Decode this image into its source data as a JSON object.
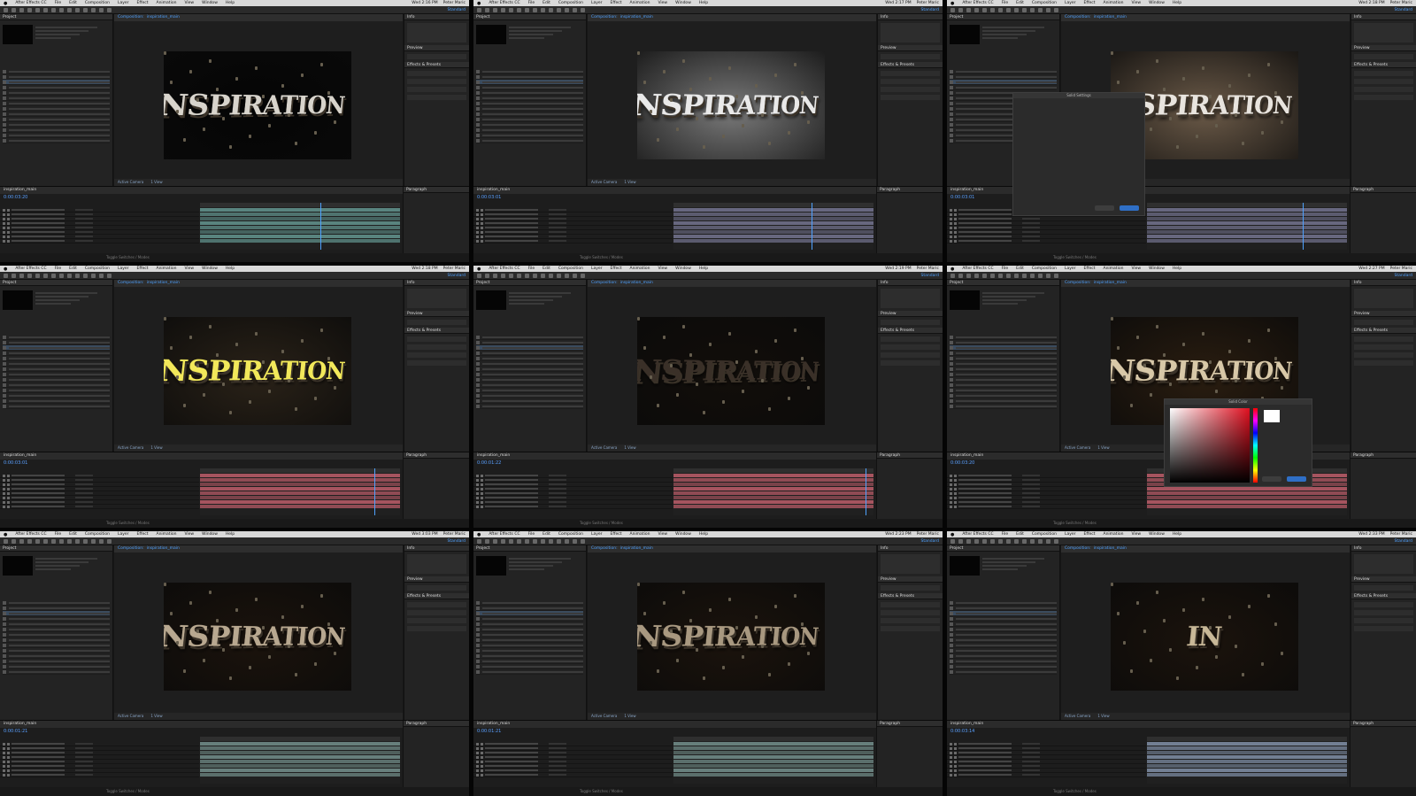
{
  "menubar": {
    "app_name": "After Effects CC",
    "menus": [
      "File",
      "Edit",
      "Composition",
      "Layer",
      "Effect",
      "Animation",
      "View",
      "Window",
      "Help"
    ],
    "user": "Peter Maric"
  },
  "common": {
    "project_tab": "Project",
    "comp_tab_prefix": "Composition:",
    "timeline_tab": "inspiration_main",
    "info_tab": "Info",
    "preview_tab": "Preview",
    "effects_tab": "Effects & Presets",
    "paragraph_tab": "Paragraph",
    "status_text": "Toggle Switches / Modes",
    "view_mode": "Active Camera",
    "view_count": "1 View",
    "workspace": "Standard"
  },
  "frames": [
    {
      "time": "Wed 2:16 PM",
      "timecode": "0:00:03:20",
      "title_text": "INSPIRATION",
      "title_color": "#d8d4cc",
      "bg": "#050505",
      "track_color": "#5f8f8a",
      "dialog": ""
    },
    {
      "time": "Wed 2:17 PM",
      "timecode": "0:00:03:01",
      "title_text": "INSPIRATION",
      "title_color": "#e9e9e9",
      "bg": "#7a7a7a",
      "track_color": "#6f6f8a",
      "dialog": ""
    },
    {
      "time": "Wed 2:18 PM",
      "timecode": "0:00:03:01",
      "title_text": "INSPIRATION",
      "title_color": "#e8e4de",
      "bg": "#6b5a48",
      "track_color": "#6f6f8a",
      "dialog": "Solid Settings"
    },
    {
      "time": "Wed 2:18 PM",
      "timecode": "0:00:03:01",
      "title_text": "INSPIRATION",
      "title_color": "#f2e85a",
      "bg": "#2a2218",
      "track_color": "#b55a66",
      "dialog": ""
    },
    {
      "time": "Wed 2:19 PM",
      "timecode": "0:00:01:22",
      "title_text": "INSPIRATION",
      "title_color": "#3a3028",
      "bg": "#120e0a",
      "track_color": "#b55a66",
      "dialog": ""
    },
    {
      "time": "Wed 2:27 PM",
      "timecode": "0:00:03:20",
      "title_text": "INSPIRATION",
      "title_color": "#d8c8a8",
      "bg": "#2a1d10",
      "track_color": "#b55a66",
      "dialog": "Solid Color"
    },
    {
      "time": "Wed 3:03 PM",
      "timecode": "0:00:01:21",
      "title_text": "INSPIRATION",
      "title_color": "#b8a890",
      "bg": "#1b130c",
      "track_color": "#6f8a86",
      "dialog": ""
    },
    {
      "time": "Wed 2:23 PM",
      "timecode": "0:00:01:21",
      "title_text": "INSPIRATION",
      "title_color": "#a89880",
      "bg": "#1b130c",
      "track_color": "#6f8a86",
      "dialog": ""
    },
    {
      "time": "Wed 2:33 PM",
      "timecode": "0:00:03:14",
      "title_text": "IN",
      "title_color": "#c8b898",
      "bg": "#1b130c",
      "track_color": "#7b8aa0",
      "dialog": ""
    }
  ],
  "colors": {
    "accent": "#4ea1ff",
    "panel": "#232323",
    "timeline_red": "#b55a66",
    "timeline_teal": "#5f8f8a"
  }
}
